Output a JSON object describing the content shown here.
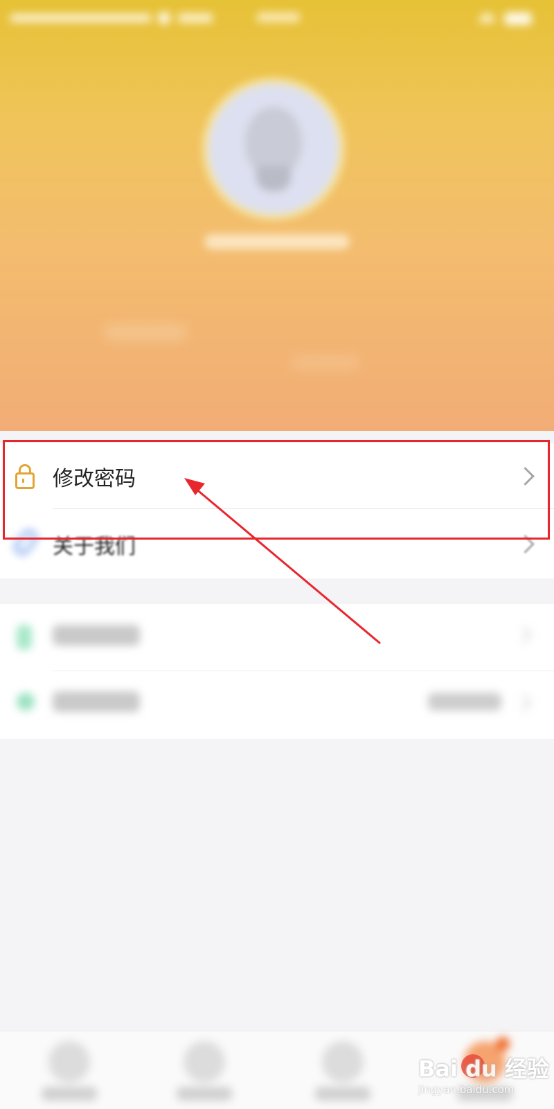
{
  "menu": {
    "change_password_label": "修改密码",
    "about_us_label": "关于我们"
  },
  "watermark": {
    "logo": "Bai du 经验",
    "domain": "jingyan.baidu.com"
  },
  "colors": {
    "header_gradient": [
      "#e6c236",
      "#f2ad76"
    ],
    "lock_icon": "#e2a533",
    "clip_icon": "#5a90e8",
    "annotation_red": "#e8262e"
  },
  "icons": {
    "lock": "lock-icon",
    "about": "paperclip-icon",
    "chevron": "chevron-right-icon"
  }
}
